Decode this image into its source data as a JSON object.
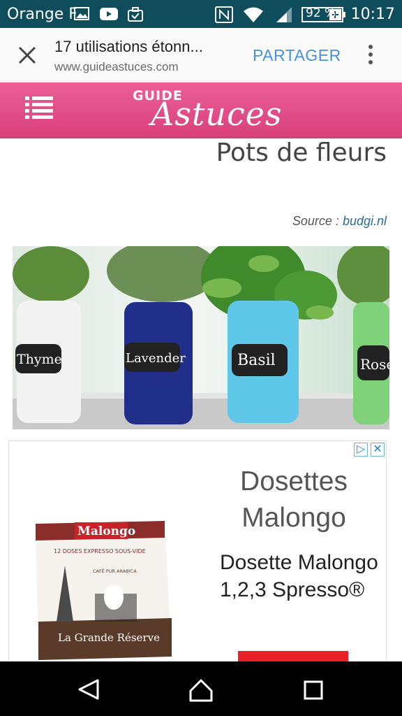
{
  "status_bar": {
    "carrier": "Orange F",
    "battery": "92 %",
    "time": "10:17",
    "icons": [
      "gallery-icon",
      "youtube-icon",
      "briefcase-check-icon",
      "nfc-icon",
      "wifi-icon",
      "signal-icon",
      "battery-icon"
    ]
  },
  "toolbar": {
    "title": "17 utilisations étonn...",
    "url": "www.guideastuces.com",
    "share_label": "PARTAGER"
  },
  "site_header": {
    "logo_small": "GUIDE",
    "logo_big": "Astuces"
  },
  "article": {
    "heading": "Pots de fleurs",
    "source_label": "Source : ",
    "source_link": "budgi.nl",
    "photo_labels": [
      "Thyme",
      "Lavender",
      "Basil",
      "Rose"
    ]
  },
  "ad": {
    "title": "Dosettes Malongo",
    "text": "Dosette Malongo 1,2,3 Spresso®",
    "product": {
      "brand": "Malongo",
      "subtitle": "12 DOSES EXPRESSO SOUS-VIDE",
      "range": "CAFÉ PUR ARABICA",
      "name": "La Grande Réserve"
    }
  },
  "colors": {
    "status_bar": "#0f4c5c",
    "header_pink": "#e3558a",
    "share_blue": "#4a90d9",
    "ad_red": "#e8202a"
  }
}
